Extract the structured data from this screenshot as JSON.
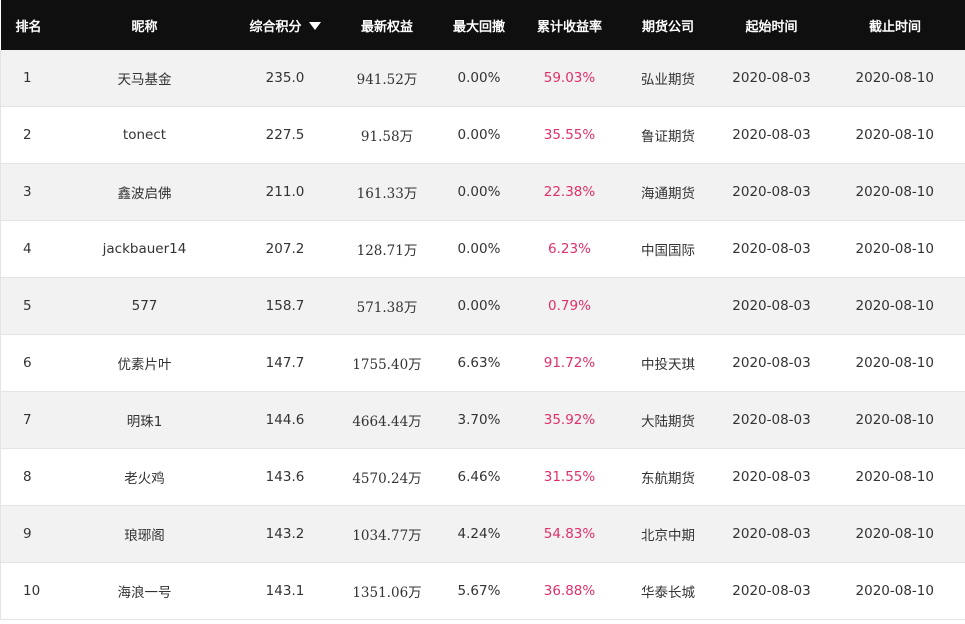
{
  "header": {
    "rank": "排名",
    "nickname": "昵称",
    "score": "综合积分",
    "equity": "最新权益",
    "drawdown": "最大回撤",
    "return": "累计收益率",
    "company": "期货公司",
    "start": "起始时间",
    "end": "截止时间"
  },
  "rows": [
    {
      "rank": "1",
      "nickname": "天马基金",
      "score": "235.0",
      "equity": "941.52万",
      "drawdown": "0.00%",
      "return": "59.03%",
      "company": "弘业期货",
      "start": "2020-08-03",
      "end": "2020-08-10"
    },
    {
      "rank": "2",
      "nickname": "tonect",
      "score": "227.5",
      "equity": "91.58万",
      "drawdown": "0.00%",
      "return": "35.55%",
      "company": "鲁证期货",
      "start": "2020-08-03",
      "end": "2020-08-10"
    },
    {
      "rank": "3",
      "nickname": "鑫波启佛",
      "score": "211.0",
      "equity": "161.33万",
      "drawdown": "0.00%",
      "return": "22.38%",
      "company": "海通期货",
      "start": "2020-08-03",
      "end": "2020-08-10"
    },
    {
      "rank": "4",
      "nickname": "jackbauer14",
      "score": "207.2",
      "equity": "128.71万",
      "drawdown": "0.00%",
      "return": "6.23%",
      "company": "中国国际",
      "start": "2020-08-03",
      "end": "2020-08-10"
    },
    {
      "rank": "5",
      "nickname": "577",
      "score": "158.7",
      "equity": "571.38万",
      "drawdown": "0.00%",
      "return": "0.79%",
      "company": "",
      "start": "2020-08-03",
      "end": "2020-08-10"
    },
    {
      "rank": "6",
      "nickname": "优素片叶",
      "score": "147.7",
      "equity": "1755.40万",
      "drawdown": "6.63%",
      "return": "91.72%",
      "company": "中投天琪",
      "start": "2020-08-03",
      "end": "2020-08-10"
    },
    {
      "rank": "7",
      "nickname": "明珠1",
      "score": "144.6",
      "equity": "4664.44万",
      "drawdown": "3.70%",
      "return": "35.92%",
      "company": "大陆期货",
      "start": "2020-08-03",
      "end": "2020-08-10"
    },
    {
      "rank": "8",
      "nickname": "老火鸡",
      "score": "143.6",
      "equity": "4570.24万",
      "drawdown": "6.46%",
      "return": "31.55%",
      "company": "东航期货",
      "start": "2020-08-03",
      "end": "2020-08-10"
    },
    {
      "rank": "9",
      "nickname": "琅琊阁",
      "score": "143.2",
      "equity": "1034.77万",
      "drawdown": "4.24%",
      "return": "54.83%",
      "company": "北京中期",
      "start": "2020-08-03",
      "end": "2020-08-10"
    },
    {
      "rank": "10",
      "nickname": "海浪一号",
      "score": "143.1",
      "equity": "1351.06万",
      "drawdown": "5.67%",
      "return": "36.88%",
      "company": "华泰长城",
      "start": "2020-08-03",
      "end": "2020-08-10"
    }
  ],
  "colors": {
    "header_bg": "#0f0f0f",
    "return_color": "#e0306a",
    "row_alt": "#f2f2f2"
  },
  "icons": {
    "sort": "sort-down-icon"
  }
}
